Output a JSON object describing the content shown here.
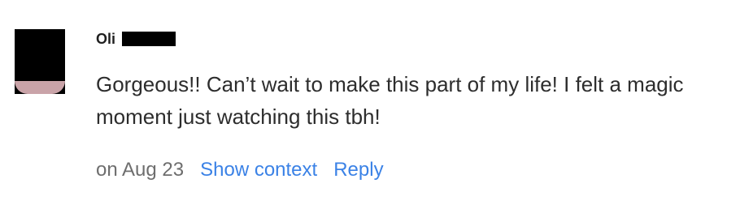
{
  "comment": {
    "author_name": "Oli",
    "body": "Gorgeous!! Can’t wait to make this part of my life! I felt a magic moment just watching this tbh!",
    "timestamp": "on Aug 23",
    "actions": {
      "show_context_label": "Show context",
      "reply_label": "Reply"
    }
  },
  "colors": {
    "link": "#3b82e6",
    "muted_text": "#6e6e6e",
    "body_text": "#2d2d2d",
    "redaction": "#000000"
  }
}
